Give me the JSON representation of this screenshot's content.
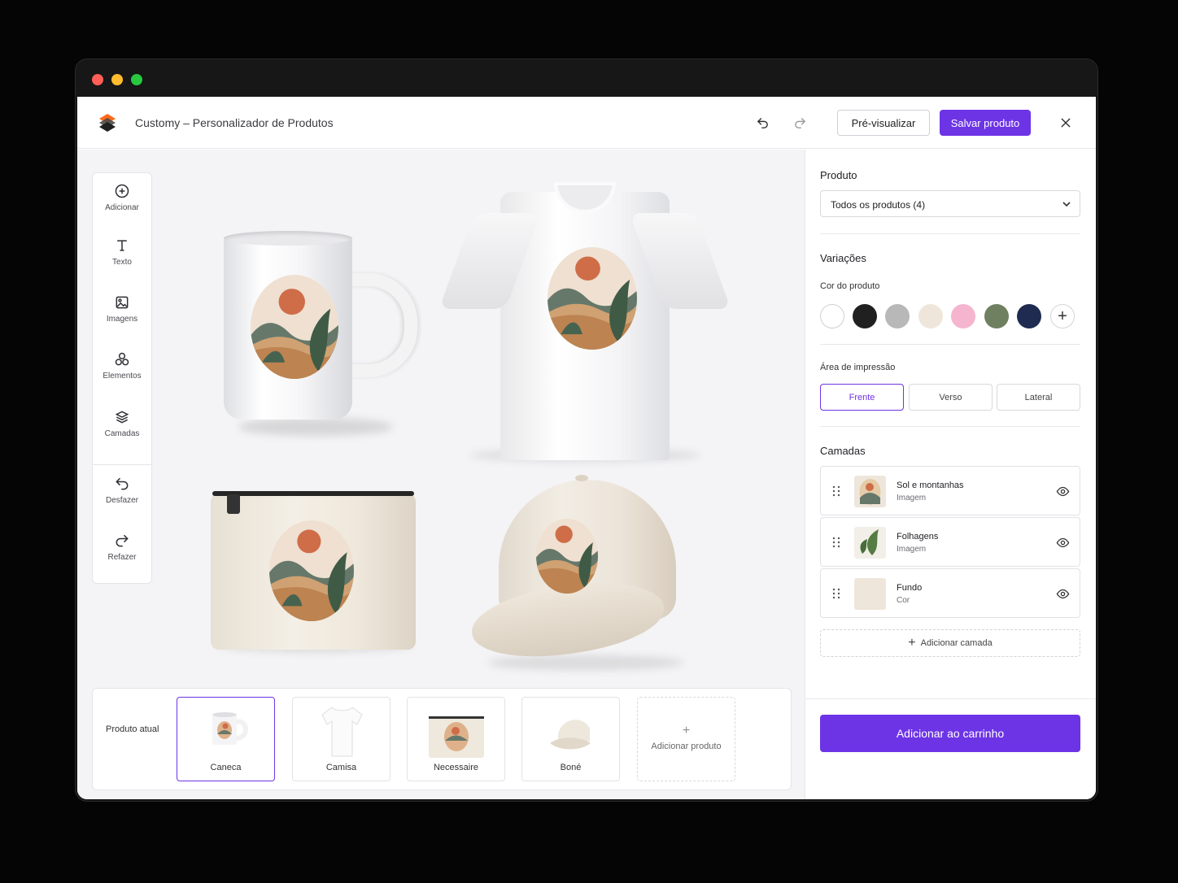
{
  "window": {
    "controls": [
      "close",
      "minimize",
      "maximize"
    ]
  },
  "header": {
    "title": "Customy – Personalizador de Produtos",
    "undo_icon": "undo-icon",
    "redo_icon": "redo-icon",
    "preview_label": "Pré-visualizar",
    "save_label": "Salvar produto",
    "close_icon": "close-icon"
  },
  "toolbar": {
    "items": [
      {
        "label": "Adicionar",
        "icon": "add-circle-icon"
      },
      {
        "label": "Texto",
        "icon": "text-icon"
      },
      {
        "label": "Imagens",
        "icon": "image-icon"
      },
      {
        "label": "Elementos",
        "icon": "shapes-icon"
      },
      {
        "label": "Camadas",
        "icon": "layers-icon"
      },
      {
        "label": "Desfazer",
        "icon": "undo-icon"
      },
      {
        "label": "Refazer",
        "icon": "redo-icon"
      }
    ]
  },
  "canvas": {
    "products": [
      "Caneca",
      "Camisa",
      "Necessaire",
      "Boné"
    ]
  },
  "product_bar": {
    "current_label": "Produto atual",
    "items": [
      {
        "label": "Caneca",
        "active": true
      },
      {
        "label": "Camisa",
        "active": false
      },
      {
        "label": "Necessaire",
        "active": false
      },
      {
        "label": "Boné",
        "active": false
      }
    ],
    "add_label": "Adicionar produto"
  },
  "sidebar": {
    "product_title": "Produto",
    "product_select": "Todos os produtos (4)",
    "variations_title": "Variações",
    "color_label": "Cor do produto",
    "colors": [
      "#ffffff",
      "#202020",
      "#b8b8b8",
      "#eee6da",
      "#f5b5cf",
      "#6f8061",
      "#1f2b50"
    ],
    "print_area_label": "Área de impressão",
    "print_areas": [
      {
        "label": "Frente",
        "active": true
      },
      {
        "label": "Verso",
        "active": false
      },
      {
        "label": "Lateral",
        "active": false
      }
    ],
    "layers_title": "Camadas",
    "layers": [
      {
        "name": "Sol e montanhas",
        "type": "Imagem"
      },
      {
        "name": "Folhagens",
        "type": "Imagem"
      },
      {
        "name": "Fundo",
        "type": "Cor"
      }
    ],
    "add_layer_label": "Adicionar camada",
    "cart_label": "Adicionar ao carrinho"
  },
  "theme": {
    "accent": "#6d34e6",
    "background": "#f4f4f6"
  }
}
